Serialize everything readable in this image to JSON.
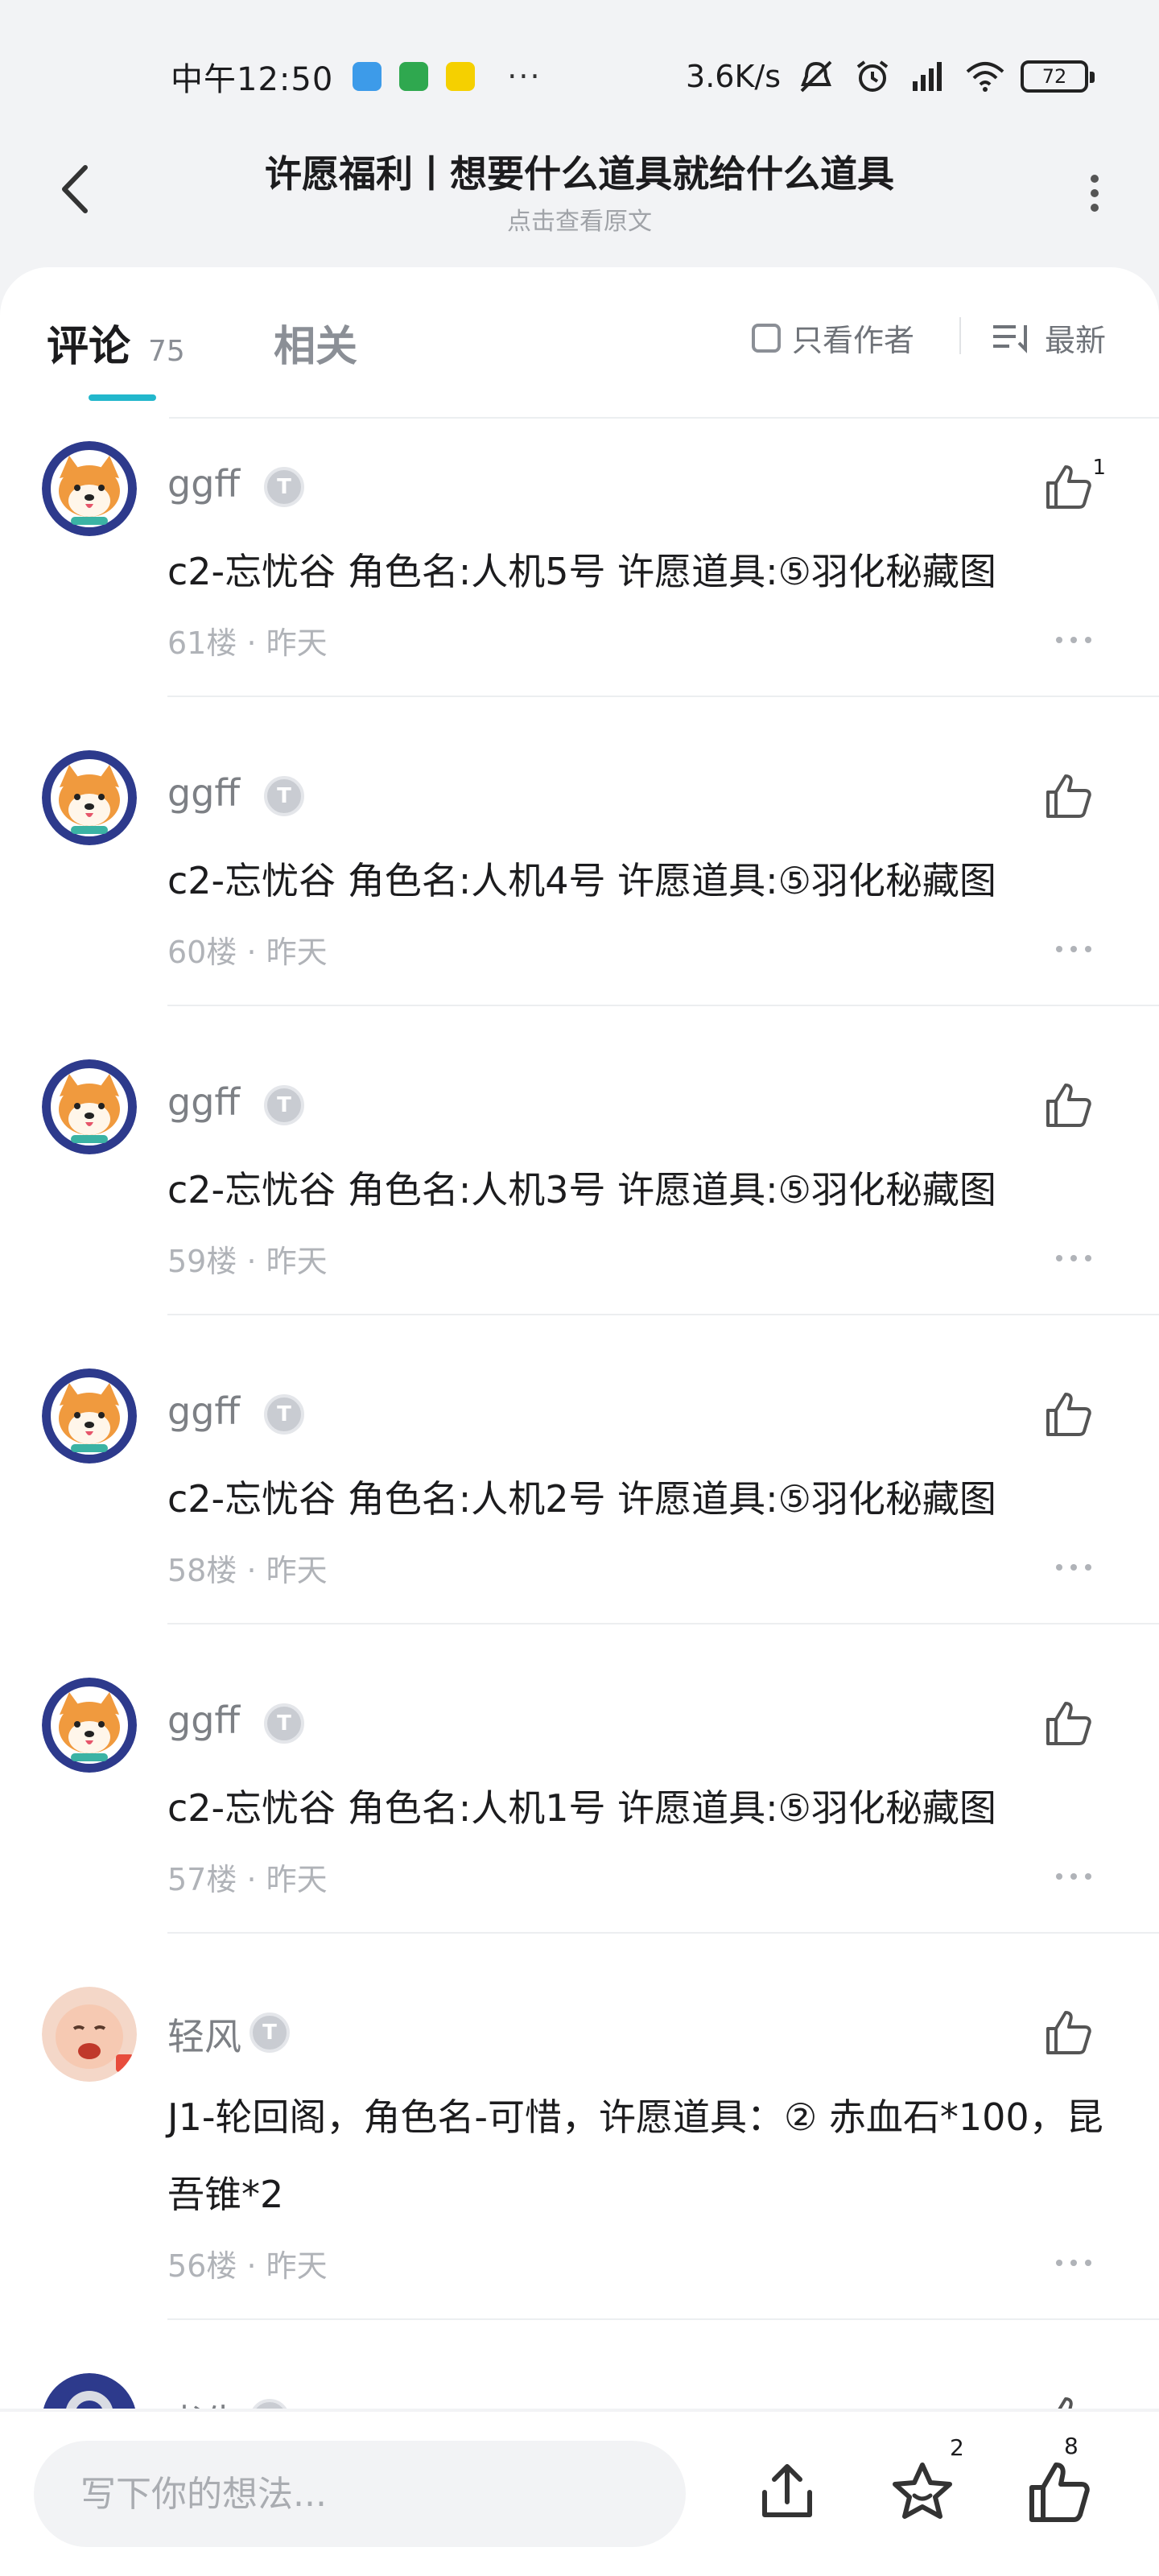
{
  "status_bar": {
    "time": "中午12:50",
    "dots": "···",
    "net_speed": "3.6K/s",
    "battery": "72"
  },
  "header": {
    "title": "许愿福利丨想要什么道具就给什么道具",
    "subtitle": "点击查看原文"
  },
  "tabs": {
    "comments_label": "评论",
    "comments_count": "75",
    "related_label": "相关",
    "author_only_label": "只看作者",
    "sort_label": "最新"
  },
  "comments": [
    {
      "user": "ggff",
      "badge": "T",
      "text": "c2-忘忧谷 角色名:人机5号 许愿道具:⑤羽化秘藏图",
      "floor": "61楼",
      "time": "昨天",
      "likes": "1"
    },
    {
      "user": "ggff",
      "badge": "T",
      "text": "c2-忘忧谷 角色名:人机4号 许愿道具:⑤羽化秘藏图",
      "floor": "60楼",
      "time": "昨天",
      "likes": ""
    },
    {
      "user": "ggff",
      "badge": "T",
      "text": "c2-忘忧谷 角色名:人机3号 许愿道具:⑤羽化秘藏图",
      "floor": "59楼",
      "time": "昨天",
      "likes": ""
    },
    {
      "user": "ggff",
      "badge": "T",
      "text": "c2-忘忧谷 角色名:人机2号 许愿道具:⑤羽化秘藏图",
      "floor": "58楼",
      "time": "昨天",
      "likes": ""
    },
    {
      "user": "ggff",
      "badge": "T",
      "text": "c2-忘忧谷 角色名:人机1号 许愿道具:⑤羽化秘藏图",
      "floor": "57楼",
      "time": "昨天",
      "likes": ""
    },
    {
      "user": "轻风",
      "badge": "T",
      "text": "J1-轮回阁，角色名-可惜，许愿道具：② 赤血石*100，昆吾锥*2",
      "floor": "56楼",
      "time": "昨天",
      "likes": ""
    },
    {
      "user": "书生",
      "badge": "T",
      "text": "",
      "floor": "",
      "time": "",
      "likes": ""
    }
  ],
  "bottom_bar": {
    "input_placeholder": "写下你的想法...",
    "fav_count": "2",
    "like_count": "8"
  },
  "colors": {
    "accent": "#22b7cc",
    "background": "#f2f3f5",
    "muted_text": "#7d8085"
  }
}
